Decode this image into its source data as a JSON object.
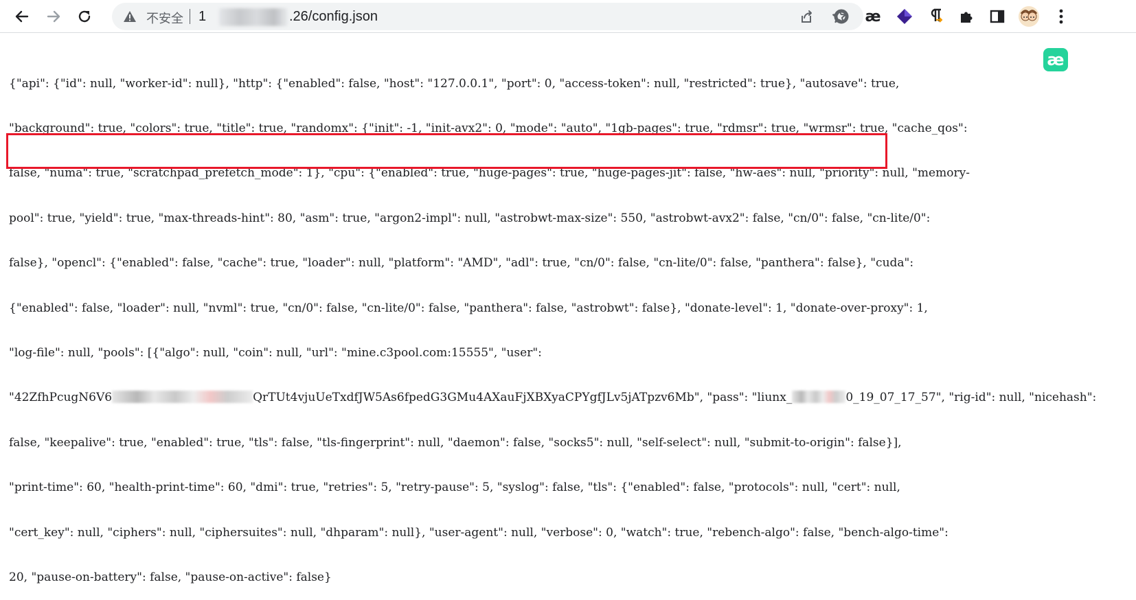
{
  "browser": {
    "security_label": "不安全",
    "url_prefix": "1",
    "url_suffix": ".26/config.json"
  },
  "extensions": {
    "ae_label": "æ"
  },
  "floating_button": {
    "label": "æ"
  },
  "colors": {
    "highlight_border": "#e8182a",
    "floating_button_bg": "#25d39b"
  },
  "document": {
    "lines": [
      "{\"api\": {\"id\": null, \"worker-id\": null}, \"http\": {\"enabled\": false, \"host\": \"127.0.0.1\", \"port\": 0, \"access-token\": null, \"restricted\": true}, \"autosave\": true,",
      "\"background\": true, \"colors\": true, \"title\": true, \"randomx\": {\"init\": -1, \"init-avx2\": 0, \"mode\": \"auto\", \"1gb-pages\": true, \"rdmsr\": true, \"wrmsr\": true, \"cache_qos\":",
      "false, \"numa\": true, \"scratchpad_prefetch_mode\": 1}, \"cpu\": {\"enabled\": true, \"huge-pages\": true, \"huge-pages-jit\": false, \"hw-aes\": null, \"priority\": null, \"memory-",
      "pool\": true, \"yield\": true, \"max-threads-hint\": 80, \"asm\": true, \"argon2-impl\": null, \"astrobwt-max-size\": 550, \"astrobwt-avx2\": false, \"cn/0\": false, \"cn-lite/0\":",
      "false}, \"opencl\": {\"enabled\": false, \"cache\": true, \"loader\": null, \"platform\": \"AMD\", \"adl\": true, \"cn/0\": false, \"cn-lite/0\": false, \"panthera\": false}, \"cuda\":",
      "{\"enabled\": false, \"loader\": null, \"nvml\": true, \"cn/0\": false, \"cn-lite/0\": false, \"panthera\": false, \"astrobwt\": false}, \"donate-level\": 1, \"donate-over-proxy\": 1,",
      "\"log-file\": null, \"pools\": [{\"algo\": null, \"coin\": null, \"url\": \"mine.c3pool.com:15555\", \"user\":",
      {
        "a": "\"42ZfhPcugN6V6",
        "b": "QrTUt4vjuUeTxdfJW5As6fpedG3GMu4AXauFjXBXyaCPYgfJLv5jATpzv6Mb\", \"pass\": \"liunx_",
        "c": "0_19_07_17_57\", \"rig-id\": null, \"nicehash\":"
      },
      "false, \"keepalive\": true, \"enabled\": true, \"tls\": false, \"tls-fingerprint\": null, \"daemon\": false, \"socks5\": null, \"self-select\": null, \"submit-to-origin\": false}],",
      "\"print-time\": 60, \"health-print-time\": 60, \"dmi\": true, \"retries\": 5, \"retry-pause\": 5, \"syslog\": false, \"tls\": {\"enabled\": false, \"protocols\": null, \"cert\": null,",
      "\"cert_key\": null, \"ciphers\": null, \"ciphersuites\": null, \"dhparam\": null}, \"user-agent\": null, \"verbose\": 0, \"watch\": true, \"rebench-algo\": false, \"bench-algo-time\":",
      "20, \"pause-on-battery\": false, \"pause-on-active\": false}"
    ]
  }
}
